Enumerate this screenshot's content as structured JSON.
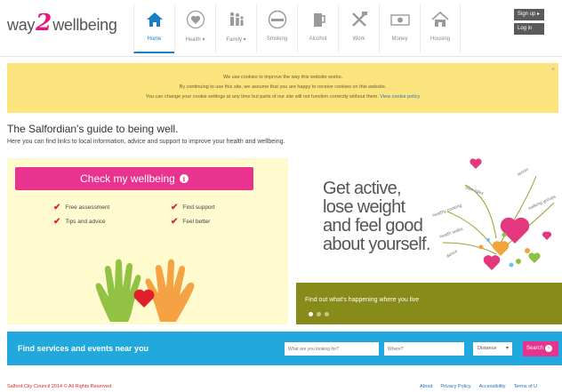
{
  "header": {
    "logo": {
      "before": "way",
      "digit": "2",
      "after": "wellbeing"
    },
    "nav": [
      {
        "label": "Home",
        "icon": "home-icon",
        "active": true
      },
      {
        "label": "Health ▾",
        "icon": "health-heart-icon",
        "active": false
      },
      {
        "label": "Family ▾",
        "icon": "family-icon",
        "active": false
      },
      {
        "label": "Smoking",
        "icon": "no-smoking-icon",
        "active": false
      },
      {
        "label": "Alcohol",
        "icon": "beer-glass-icon",
        "active": false
      },
      {
        "label": "Work",
        "icon": "tools-icon",
        "active": false
      },
      {
        "label": "Money",
        "icon": "banknote-icon",
        "active": false
      },
      {
        "label": "Housing",
        "icon": "house-icon",
        "active": false
      }
    ],
    "sign_up": "Sign up ▸",
    "log_in": "Log in"
  },
  "cookie": {
    "line1": "We use cookies to improve the way this website works.",
    "line2": "By continuing to use this site, we assume that you are happy to receive cookies on this website.",
    "line3": "You can change your cookie settings at any time but parts of our site will not function correctly without them.",
    "link": "View cookie policy",
    "close": "×"
  },
  "intro": {
    "title": "The Salfordian's guide to being well.",
    "text": "Here you can find links to local information, advice and support to improve your health and wellbeing."
  },
  "check": {
    "button": "Check my wellbeing",
    "benefits": [
      "Free assessment",
      "Find support",
      "Tips and advice",
      "Feel better"
    ]
  },
  "hero": {
    "lines": [
      "Get active,",
      "lose weight",
      "and feel good",
      "about yourself."
    ],
    "caption": "Find out what's happening where you live",
    "slides": 3,
    "current_slide": 1
  },
  "services": {
    "title": "Find services and events near you",
    "what_placeholder": "What are you looking for?",
    "where_placeholder": "Where?",
    "distance": "Distance",
    "search": "Search"
  },
  "footer": {
    "copyright": "Salford City Council 2014 © All Rights Reserved",
    "links": [
      "About",
      "Privacy Policy",
      "Accessibility",
      "Terms of U"
    ]
  },
  "colors": {
    "brand_pink": "#e8338f",
    "nav_active": "#1a7fc4",
    "cookie_bg": "#fbe37e",
    "services_bg": "#21a8dc",
    "hero_caption_bg": "#868b1a"
  }
}
